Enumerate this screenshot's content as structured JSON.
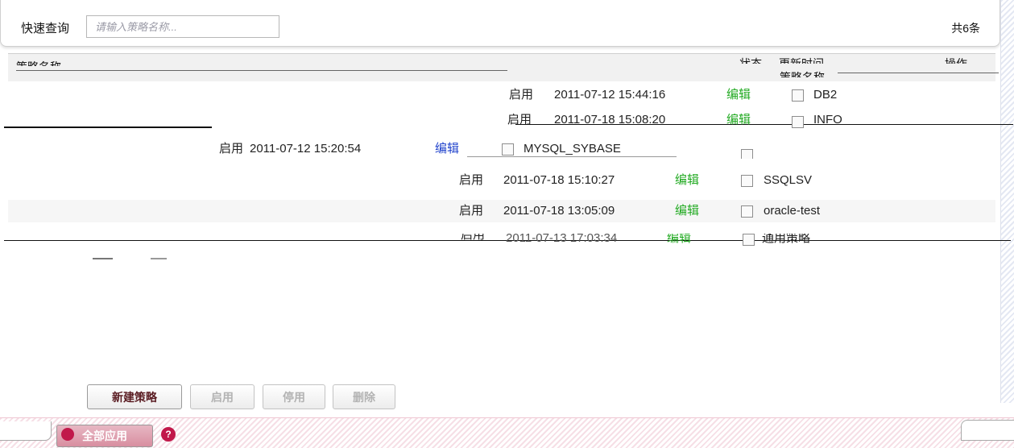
{
  "search": {
    "label": "快速查询",
    "placeholder": "请输入策略名称...",
    "total": "共6条"
  },
  "table": {
    "headers": [
      "策略名称",
      "状态",
      "更新时间",
      "操作",
      "策略名称"
    ],
    "rows": [
      {
        "status": "启用",
        "time": "2011-07-12 15:44:16",
        "action": "编辑",
        "policy": "DB2"
      },
      {
        "status": "启用",
        "time": "2011-07-18 15:08:20",
        "action": "编辑",
        "policy": "INFO"
      },
      {
        "status": "启用",
        "time": "2011-07-12 15:20:54",
        "action": "编辑",
        "policy": "MYSQL_SYBASE"
      },
      {
        "status": "启用",
        "time": "2011-07-18 15:10:27",
        "action": "编辑",
        "policy": "SSQLSV"
      },
      {
        "status": "启用",
        "time": "2011-07-18 13:05:09",
        "action": "编辑",
        "policy": "oracle-test"
      },
      {
        "status": "启用",
        "time": "2011-07-13 17:03:34",
        "action": "编辑",
        "policy": "通用策略"
      }
    ]
  },
  "buttons": {
    "new_policy": "新建策略",
    "enable": "启用",
    "disable": "停用",
    "delete": "删除"
  },
  "bottom": {
    "apply_all": "全部应用",
    "help": "?"
  }
}
